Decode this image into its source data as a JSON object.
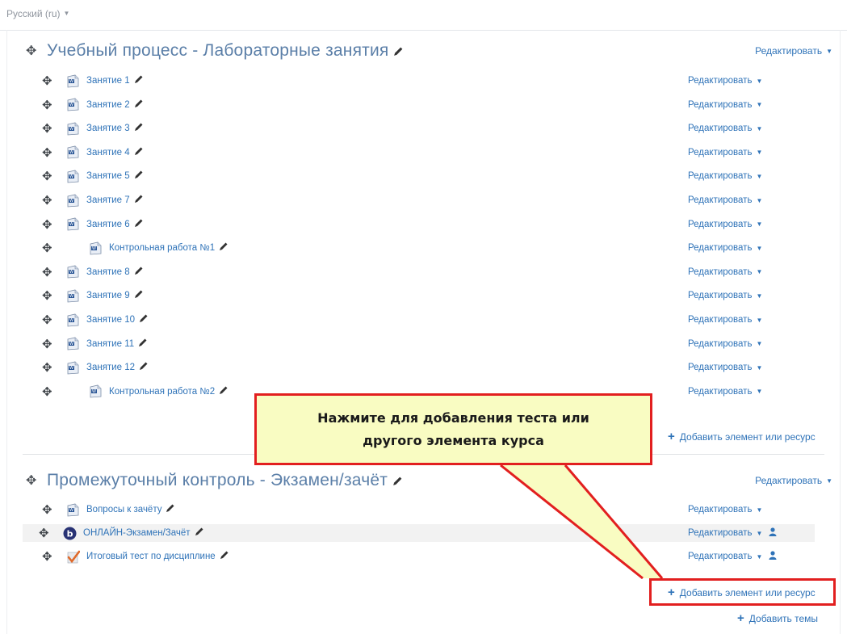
{
  "language": {
    "label": "Русский ‎(ru)‎"
  },
  "colors": {
    "link": "#2f73b8",
    "section_title": "#5b7fa8",
    "callout_border": "#e21f1f",
    "callout_fill": "#f9fcc2"
  },
  "section1": {
    "title": "Учебный процесс - Лабораторные занятия",
    "edit_label": "Редактировать",
    "add_label": "Добавить элемент или ресурс",
    "items": [
      {
        "name": "Занятие 1",
        "icon": "document-icon",
        "edit": "Редактировать"
      },
      {
        "name": "Занятие 2",
        "icon": "document-icon",
        "edit": "Редактировать"
      },
      {
        "name": "Занятие 3",
        "icon": "document-icon",
        "edit": "Редактировать"
      },
      {
        "name": "Занятие 4",
        "icon": "document-icon",
        "edit": "Редактировать"
      },
      {
        "name": "Занятие 5",
        "icon": "document-icon",
        "edit": "Редактировать"
      },
      {
        "name": "Занятие 7",
        "icon": "document-icon",
        "edit": "Редактировать"
      },
      {
        "name": "Занятие 6",
        "icon": "document-icon",
        "edit": "Редактировать"
      },
      {
        "name": "Контрольная работа №1",
        "icon": "document-icon",
        "edit": "Редактировать"
      },
      {
        "name": "Занятие 8",
        "icon": "document-icon",
        "edit": "Редактировать"
      },
      {
        "name": "Занятие 9",
        "icon": "document-icon",
        "edit": "Редактировать"
      },
      {
        "name": "Занятие 10",
        "icon": "document-icon",
        "edit": "Редактировать"
      },
      {
        "name": "Занятие 11",
        "icon": "document-icon",
        "edit": "Редактировать"
      },
      {
        "name": "Занятие 12",
        "icon": "document-icon",
        "edit": "Редактировать"
      },
      {
        "name": "Контрольная работа №2",
        "icon": "document-icon",
        "edit": "Редактировать"
      }
    ]
  },
  "section2": {
    "title": "Промежуточный контроль - Экзамен/зачёт",
    "edit_label": "Редактировать",
    "add_label": "Добавить элемент или ресурс",
    "items": [
      {
        "name": "Вопросы к зачёту",
        "icon": "document-icon",
        "edit": "Редактировать"
      },
      {
        "name": "ОНЛАЙН-Экзамен/Зачёт",
        "icon": "bigbluebutton-icon",
        "edit": "Редактировать"
      },
      {
        "name": "Итоговый тест по дисциплине",
        "icon": "quiz-check-icon",
        "edit": "Редактировать"
      }
    ]
  },
  "add_topics_label": "Добавить темы",
  "callout": {
    "line1": "Нажмите для добавления теста или",
    "line2": "другого элемента курса"
  }
}
